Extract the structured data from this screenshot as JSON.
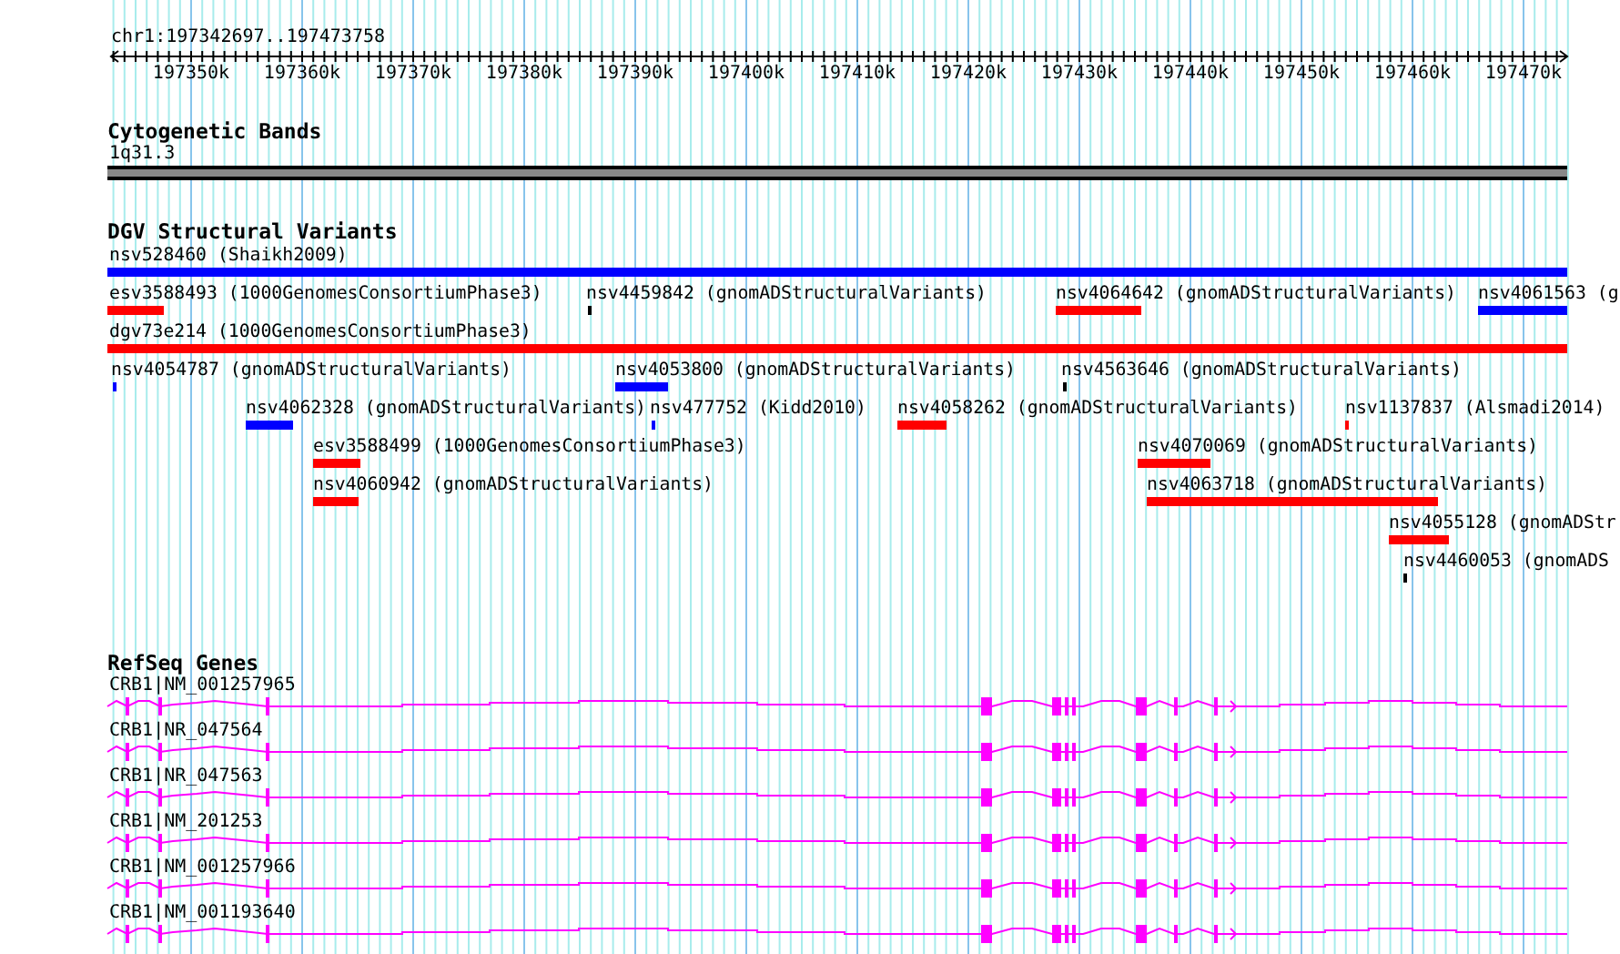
{
  "ruler": {
    "location": "chr1:197342697..197473758",
    "ticks": [
      "197350k",
      "197360k",
      "197370k",
      "197380k",
      "197390k",
      "197400k",
      "197410k",
      "197420k",
      "197430k",
      "197440k",
      "197450k",
      "197460k",
      "197470k"
    ]
  },
  "cytobands": {
    "title": "Cytogenetic Bands",
    "bands": [
      {
        "label": "1q31.3"
      }
    ]
  },
  "variants": {
    "title": "DGV Structural Variants",
    "rows": [
      [
        {
          "label": "nsv528460 (Shaikh2009)",
          "color": "#0000ff"
        }
      ],
      [
        {
          "label": "esv3588493 (1000GenomesConsortiumPhase3)",
          "color": "#ff0000"
        },
        {
          "label": "nsv4459842 (gnomADStructuralVariants)",
          "color": "#000000"
        },
        {
          "label": "nsv4064642 (gnomADStructuralVariants)",
          "color": "#ff0000"
        },
        {
          "label": "nsv4061563 (g",
          "color": "#0000ff"
        }
      ],
      [
        {
          "label": "dgv73e214 (1000GenomesConsortiumPhase3)",
          "color": "#ff0000"
        }
      ],
      [
        {
          "label": "nsv4054787 (gnomADStructuralVariants)",
          "color": "#0000ff"
        },
        {
          "label": "nsv4053800 (gnomADStructuralVariants)",
          "color": "#0000ff"
        },
        {
          "label": "nsv4563646 (gnomADStructuralVariants)",
          "color": "#000000"
        }
      ],
      [
        {
          "label": "nsv4062328 (gnomADStructuralVariants)",
          "color": "#0000ff"
        },
        {
          "label": "nsv477752 (Kidd2010)",
          "color": "#0000ff"
        },
        {
          "label": "nsv4058262 (gnomADStructuralVariants)",
          "color": "#ff0000"
        },
        {
          "label": "nsv1137837 (Alsmadi2014)",
          "color": "#ff0000"
        }
      ],
      [
        {
          "label": "esv3588499 (1000GenomesConsortiumPhase3)",
          "color": "#ff0000"
        },
        {
          "label": "nsv4070069 (gnomADStructuralVariants)",
          "color": "#ff0000"
        }
      ],
      [
        {
          "label": "nsv4060942 (gnomADStructuralVariants)",
          "color": "#ff0000"
        },
        {
          "label": "nsv4063718 (gnomADStructuralVariants)",
          "color": "#ff0000"
        }
      ],
      [
        {
          "label": "nsv4055128 (gnomADStr",
          "color": "#ff0000"
        }
      ],
      [
        {
          "label": "nsv4460053 (gnomADS",
          "color": "#000000"
        }
      ]
    ]
  },
  "genes": {
    "title": "RefSeq Genes",
    "transcripts": [
      {
        "label": "CRB1|NM_001257965"
      },
      {
        "label": "CRB1|NR_047564"
      },
      {
        "label": "CRB1|NR_047563"
      },
      {
        "label": "CRB1|NM_201253"
      },
      {
        "label": "CRB1|NM_001257966"
      },
      {
        "label": "CRB1|NM_001193640"
      }
    ]
  }
}
